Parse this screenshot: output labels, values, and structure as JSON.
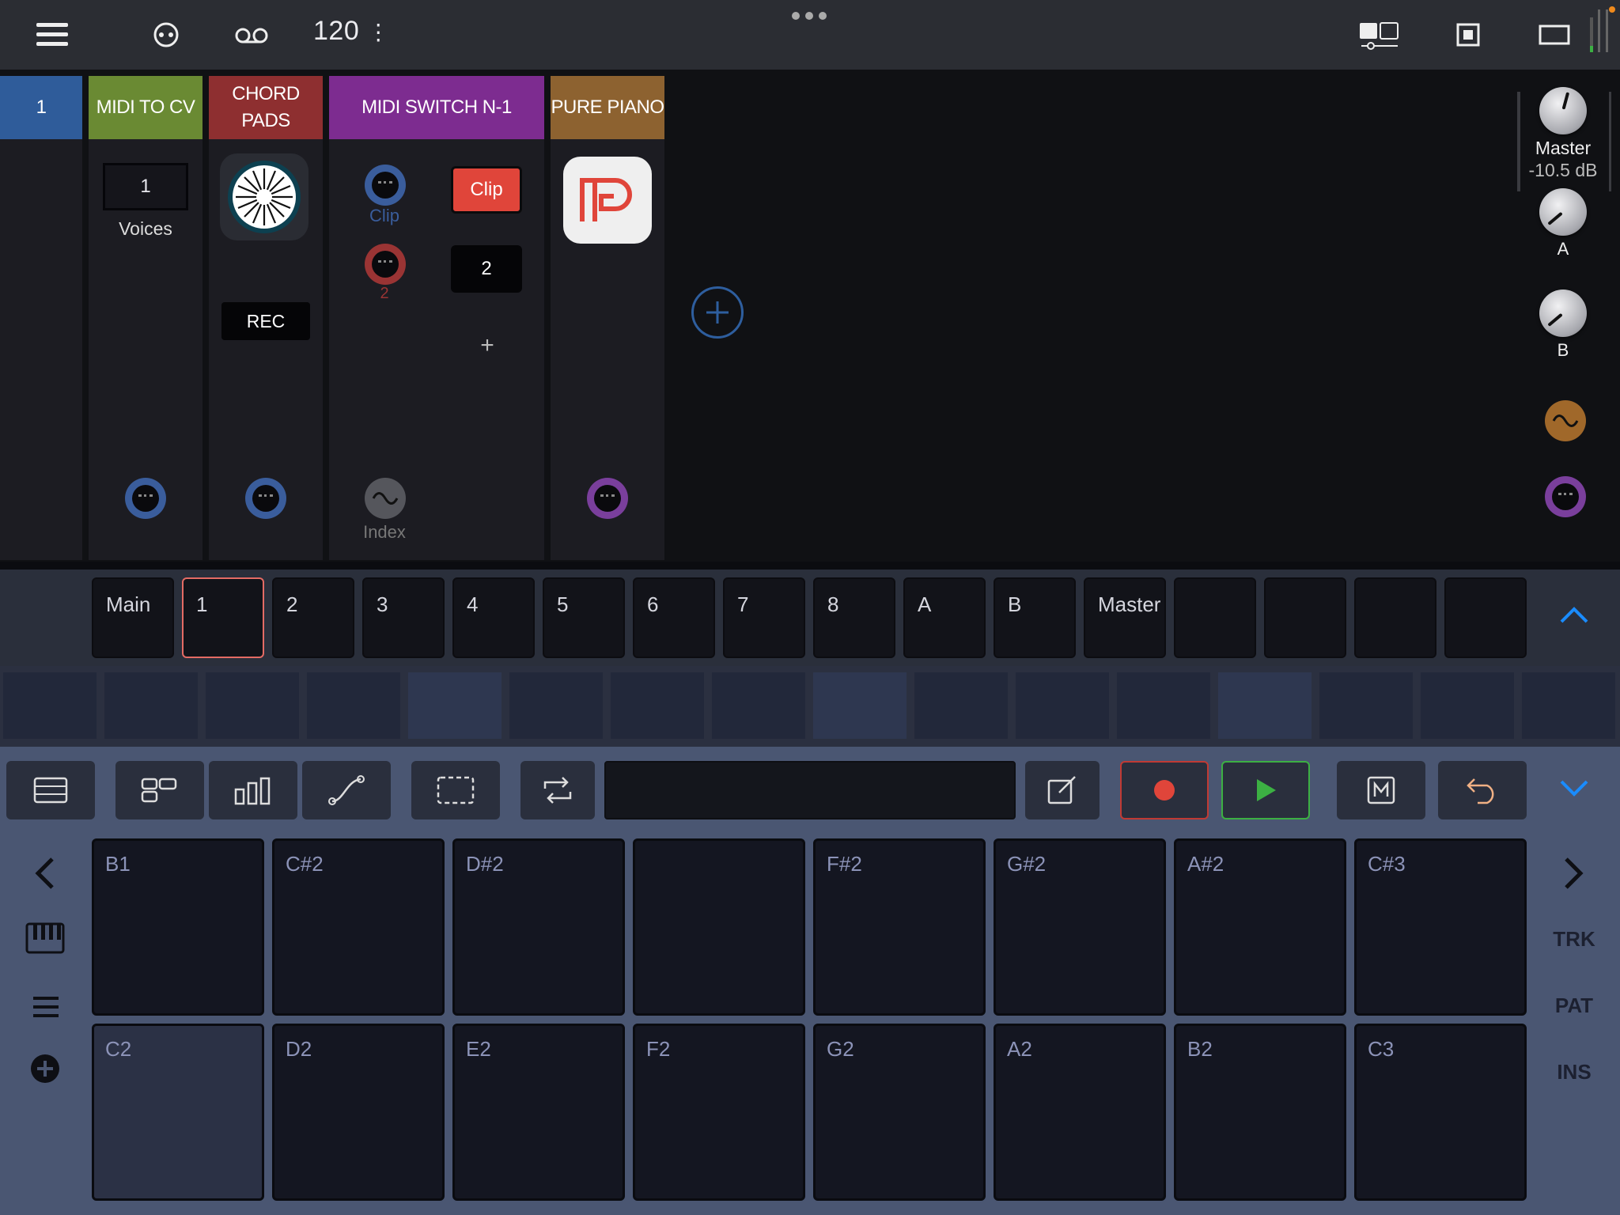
{
  "topbar": {
    "bpm": "120",
    "icons": [
      "menu-icon",
      "link-icon",
      "tape-icon",
      "more-icon",
      "split-view-icon",
      "stop-frame-icon",
      "window-icon",
      "level-meter-icon"
    ]
  },
  "rack": {
    "columns": [
      {
        "name": "1",
        "color": "#2f5c9a"
      },
      {
        "name": "MIDI TO CV",
        "color": "#6a8a33",
        "value": "1",
        "value_label": "Voices"
      },
      {
        "name": "CHORD\nPADS",
        "color": "#8e2f30",
        "button": "REC"
      },
      {
        "name": "MIDI SWITCH N-1",
        "color": "#7d2c90",
        "in1_label": "Clip",
        "in2_label": "2",
        "clip_button": "Clip",
        "out_button": "2",
        "add": "+",
        "index_label": "Index"
      },
      {
        "name": "PURE PIANO",
        "color": "#8d6230"
      }
    ],
    "master": {
      "name": "Master",
      "level": "-10.5 dB",
      "send_a": "A",
      "send_b": "B"
    }
  },
  "channels": {
    "tabs": [
      "Main",
      "1",
      "2",
      "3",
      "4",
      "5",
      "6",
      "7",
      "8",
      "A",
      "B",
      "Master",
      "",
      "",
      "",
      ""
    ],
    "selected": "1"
  },
  "pads": {
    "top": [
      "B1",
      "C#2",
      "D#2",
      "",
      "F#2",
      "G#2",
      "A#2",
      "C#3"
    ],
    "bottom": [
      "C2",
      "D2",
      "E2",
      "F2",
      "G2",
      "A2",
      "B2",
      "C3"
    ]
  },
  "side": {
    "trk": "TRK",
    "pat": "PAT",
    "ins": "INS"
  },
  "colors": {
    "record": "#e0453a",
    "play": "#3cb043",
    "accent_blue": "#1a8cff",
    "selected_tab": "#e46b64"
  }
}
